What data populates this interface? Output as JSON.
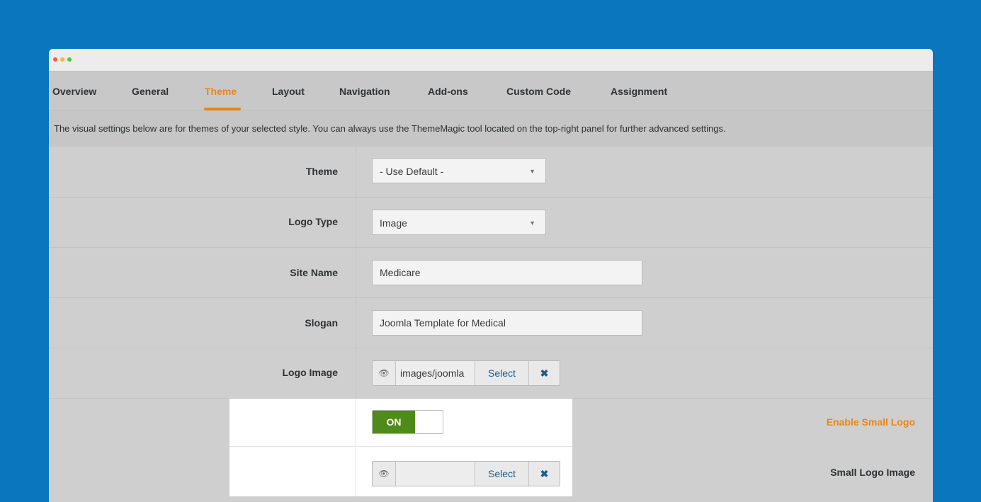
{
  "tabs": [
    {
      "label": "Overview"
    },
    {
      "label": "General"
    },
    {
      "label": "Theme"
    },
    {
      "label": "Layout"
    },
    {
      "label": "Navigation"
    },
    {
      "label": "Add-ons"
    },
    {
      "label": "Custom Code"
    },
    {
      "label": "Assignment"
    }
  ],
  "active_tab": "Theme",
  "info_text": "The visual settings below are for themes of your selected style. You can always use the ThemeMagic tool located on the top-right panel for further advanced settings.",
  "fields": {
    "theme": {
      "label": "Theme",
      "value": "- Use Default -"
    },
    "logo_type": {
      "label": "Logo Type",
      "value": "Image"
    },
    "site_name": {
      "label": "Site Name",
      "value": "Medicare"
    },
    "slogan": {
      "label": "Slogan",
      "value": "Joomla Template for Medical"
    },
    "logo_image": {
      "label": "Logo Image",
      "path": "images/joomla",
      "select_label": "Select",
      "clear_label": "✖"
    },
    "enable_small_logo": {
      "label": "Enable Small Logo",
      "value": "ON"
    },
    "small_logo_image": {
      "label": "Small Logo Image",
      "path": "",
      "select_label": "Select",
      "clear_label": "✖"
    }
  },
  "colors": {
    "background": "#0a76bd",
    "accent": "#e8861a",
    "toggle_on": "#4f8b19",
    "link": "#1f5a8a"
  }
}
